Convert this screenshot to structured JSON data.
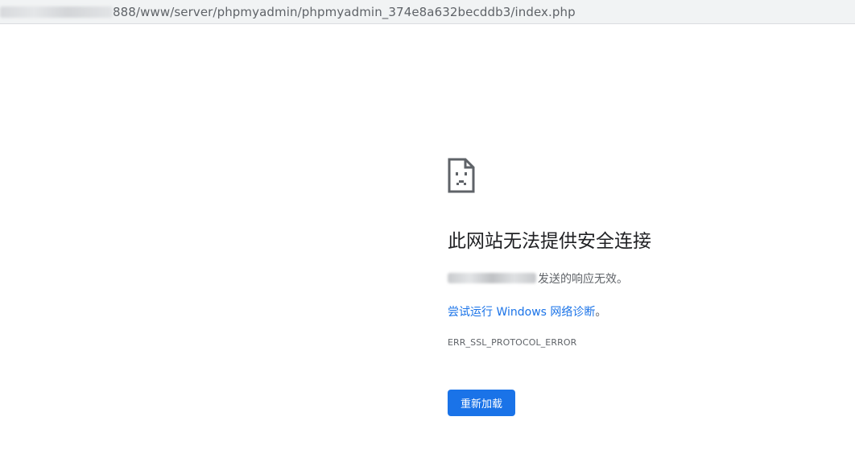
{
  "address_bar": {
    "url_visible": "888/www/server/phpmyadmin/phpmyadmin_374e8a632becddb3/index.php"
  },
  "error_page": {
    "icon": "sad-page-icon",
    "heading": "此网站无法提供安全连接",
    "description_suffix": "发送的响应无效。",
    "suggestion_link": "尝试运行 Windows 网络诊断",
    "suggestion_end": "。",
    "error_code": "ERR_SSL_PROTOCOL_ERROR",
    "reload_button": "重新加载"
  },
  "colors": {
    "link": "#1a73e8",
    "button_bg": "#1a73e8",
    "heading": "#202124",
    "body_text": "#5f6368"
  }
}
